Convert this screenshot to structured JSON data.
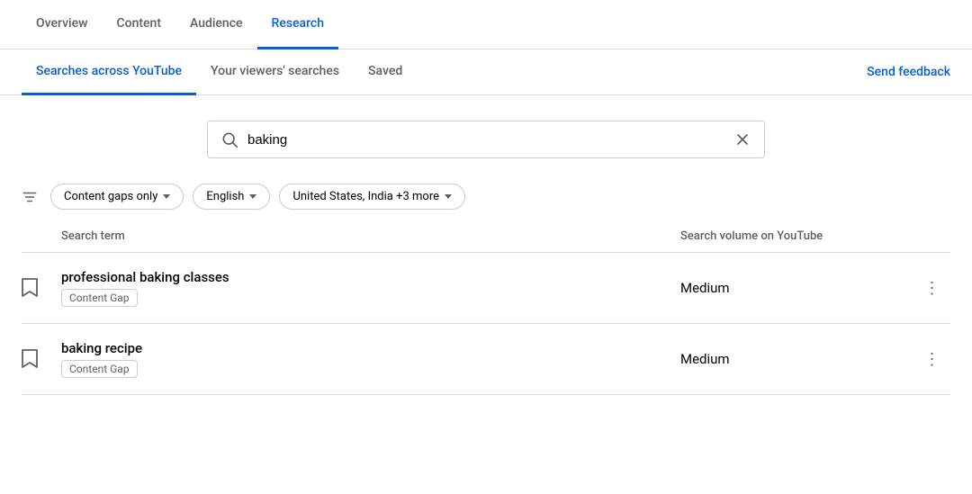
{
  "top_nav": {
    "tabs": [
      {
        "id": "overview",
        "label": "Overview",
        "active": false
      },
      {
        "id": "content",
        "label": "Content",
        "active": false
      },
      {
        "id": "audience",
        "label": "Audience",
        "active": false
      },
      {
        "id": "research",
        "label": "Research",
        "active": true
      }
    ]
  },
  "sub_nav": {
    "tabs": [
      {
        "id": "searches-across-youtube",
        "label": "Searches across YouTube",
        "active": true
      },
      {
        "id": "viewers-searches",
        "label": "Your viewers' searches",
        "active": false
      },
      {
        "id": "saved",
        "label": "Saved",
        "active": false
      }
    ],
    "send_feedback_label": "Send feedback"
  },
  "search": {
    "value": "baking",
    "placeholder": "Search",
    "icon": "search-icon",
    "clear_icon": "clear-icon"
  },
  "filters": {
    "filter_icon": "filter-lines-icon",
    "chips": [
      {
        "id": "content-gaps",
        "label": "Content gaps only",
        "has_dropdown": true
      },
      {
        "id": "language",
        "label": "English",
        "has_dropdown": true
      },
      {
        "id": "location",
        "label": "United States, India +3 more",
        "has_dropdown": true
      }
    ]
  },
  "table": {
    "columns": [
      {
        "id": "search-term",
        "label": "Search term"
      },
      {
        "id": "search-volume",
        "label": "Search volume on YouTube"
      }
    ],
    "rows": [
      {
        "id": "row-1",
        "term": "professional baking classes",
        "badge": "Content Gap",
        "volume": "Medium"
      },
      {
        "id": "row-2",
        "term": "baking recipe",
        "badge": "Content Gap",
        "volume": "Medium"
      }
    ]
  }
}
